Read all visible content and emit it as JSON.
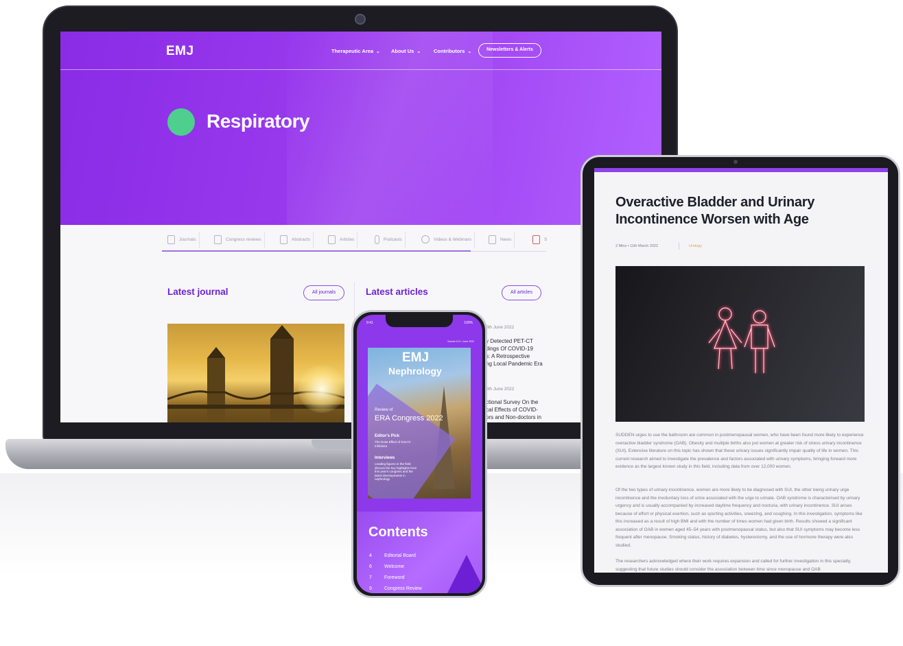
{
  "laptop": {
    "nav": {
      "logo": "EMJ",
      "items": [
        "Therapeutic Area",
        "About Us",
        "Contributors"
      ],
      "cta": "Newsletters & Alerts"
    },
    "hero_title": "Respiratory",
    "tabs": [
      "Journals",
      "Congress reviews",
      "Abstracts",
      "Articles",
      "Podcasts",
      "Videos & Webinars",
      "News",
      "S"
    ],
    "latest_journal": {
      "title": "Latest journal",
      "button": "All journals"
    },
    "latest_articles": {
      "title": "Latest articles",
      "button": "All articles",
      "items": [
        {
          "date": "0th June 2022",
          "lines": [
            "y Detected PET-CT",
            "dings Of COVID-19",
            "s: A Retrospective",
            "ng Local Pandemic Era"
          ]
        },
        {
          "date": "0th June 2022",
          "lines": [
            "ctional Survey On the",
            "cal Effects of COVID-",
            "ors and Non-doctors in"
          ]
        }
      ]
    }
  },
  "tablet": {
    "title": "Overactive Bladder and Urinary Incontinence Worsen with Age",
    "meta": "2 Mins  •  11th March 2022",
    "tag": "Urology",
    "paragraphs": [
      "SUDDEN urges to use the bathroom are common in postmenopausal women, who have been found more likely to experience overactive bladder syndrome (OAB). Obesity and multiple births also put women at greater risk of stress urinary incontinence (SUI). Extensive literature on this topic has shown that these urinary issues significantly impair quality of life in women. This current research aimed to investigate the prevalence and factors associated with urinary symptoms, bringing forward more evidence as the largest known study in this field, including data from over 12,000 women.",
      "Of the two types of urinary incontinence, women are more likely to be diagnosed with SUI, the other being urinary urge incontinence and the involuntary loss of urine associated with the urge to urinate. OAB syndrome is characterised by urinary urgency and is usually accompanied by increased daytime frequency and nocturia, with urinary incontinence. SUI arises because of effort or physical exertion, such as sporting activities, sneezing, and coughing. In this investigation, symptoms like this increased as a result of high BMI and with the number of times women had given birth. Results showed a significant association of OAB in women aged 45–54 years with postmenopausal status, but also that SUI symptoms may become less frequent after menopause. Smoking status, history of diabetes, hysterectomy, and the use of hormone therapy were also studied.",
      "The researchers acknowledged where their work requires expansion and called for further investigation in this specialty, suggesting that future studies should consider the association between time since menopause and OAB"
    ]
  },
  "phone": {
    "status_time": "9:41",
    "status_battery": "100%",
    "cover_meta": "Volume 10.2  •  June 2022",
    "cover_logo": "EMJ",
    "cover_subtitle": "Nephrology",
    "review_of": "Review of",
    "congress": "ERA Congress 2022",
    "editors_pick_h": "Editor's Pick",
    "editors_pick": "The Dose Effect of SGLT2 Inhibitors",
    "interviews_h": "Interviews",
    "interviews": "Leading figures in the field discuss the key highlights from this year's congress and the latest developments in nephrology",
    "contents_title": "Contents",
    "toc": [
      {
        "num": "4",
        "label": "Editorial Board"
      },
      {
        "num": "6",
        "label": "Welcome"
      },
      {
        "num": "7",
        "label": "Foreword"
      },
      {
        "num": "9",
        "label": "Congress Review"
      }
    ]
  },
  "colors": {
    "brand_purple": "#8a2be6",
    "accent_green": "#4ecf8e",
    "tag_orange": "#e2a23a"
  }
}
